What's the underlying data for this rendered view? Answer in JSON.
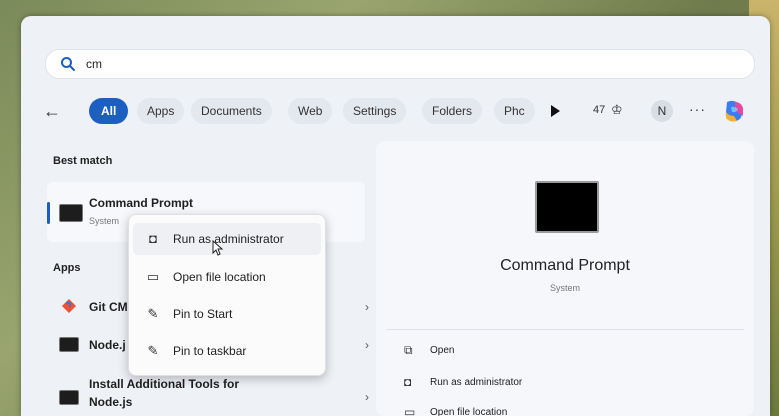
{
  "search": {
    "value": "cm",
    "icon": "search-icon"
  },
  "filters": {
    "back_icon": "←",
    "chips": [
      "All",
      "Apps",
      "Documents",
      "Web",
      "Settings",
      "Folders",
      "Phc"
    ],
    "points": "47",
    "avatar": "N",
    "more": "···"
  },
  "left": {
    "best_match_title": "Best match",
    "best_match": {
      "name": "Command Prompt",
      "sub": "System"
    },
    "apps_title": "Apps",
    "apps": [
      {
        "name": "Git CM"
      },
      {
        "name": "Node.j"
      },
      {
        "name": "Install Additional Tools for",
        "name2": "Node.js"
      }
    ]
  },
  "context_menu": {
    "items": [
      {
        "label": "Run as administrator",
        "icon": "shield-icon"
      },
      {
        "label": "Open file location",
        "icon": "folder-icon"
      },
      {
        "label": "Pin to Start",
        "icon": "pin-icon"
      },
      {
        "label": "Pin to taskbar",
        "icon": "pin-icon"
      }
    ]
  },
  "right_pane": {
    "title": "Command Prompt",
    "subtitle": "System",
    "actions": [
      {
        "label": "Open",
        "icon": "open-icon"
      },
      {
        "label": "Run as administrator",
        "icon": "shield-icon"
      },
      {
        "label": "Open file location",
        "icon": "folder-icon"
      }
    ]
  },
  "colors": {
    "accent": "#1c5fc0"
  }
}
